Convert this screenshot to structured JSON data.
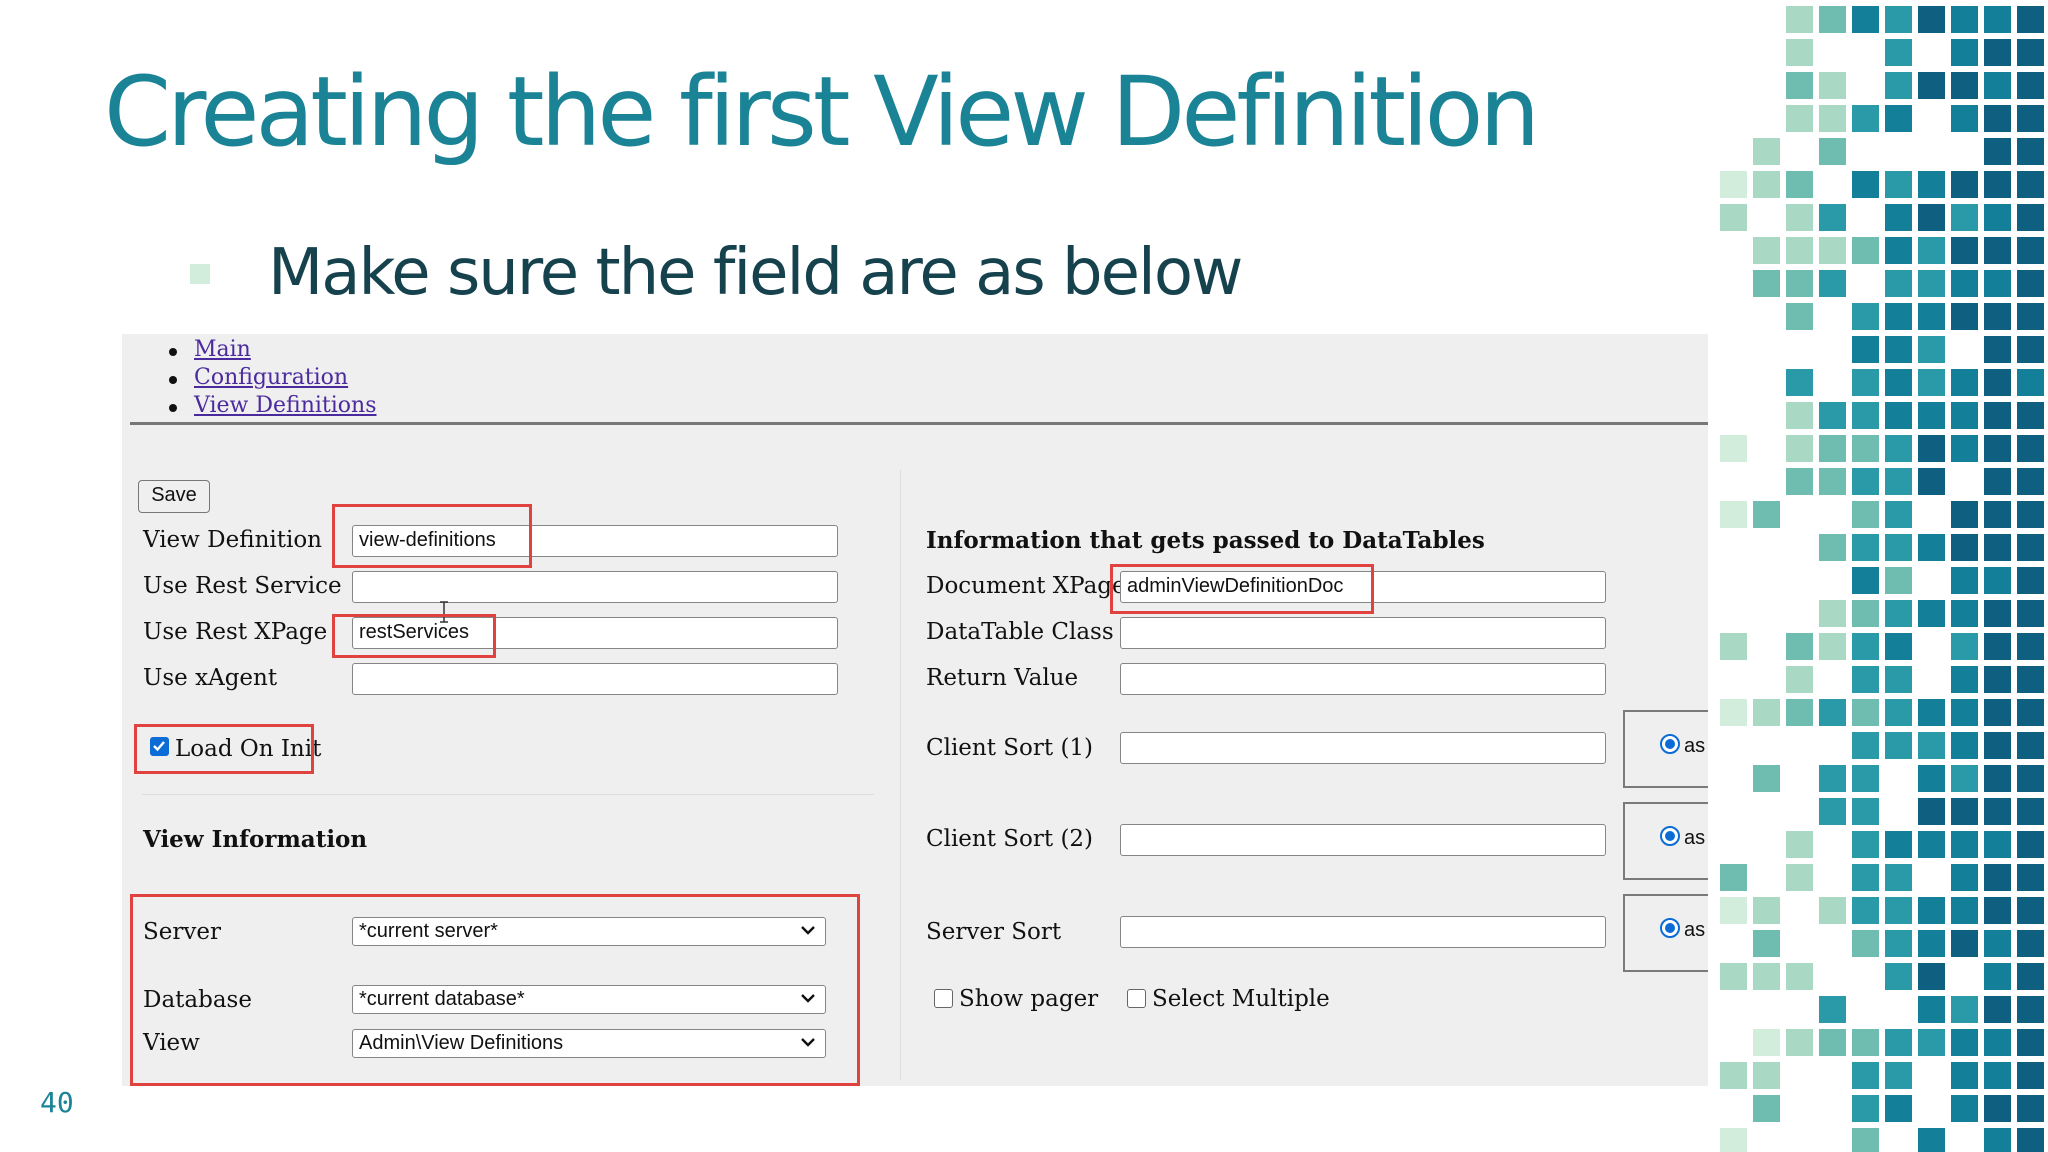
{
  "slide": {
    "title": "Creating the first View Definition",
    "bullet": "Make sure the field are as below",
    "page_number": "40",
    "accent_color": "#1a8395"
  },
  "nav": {
    "items": [
      {
        "label": "Main"
      },
      {
        "label": "Configuration"
      },
      {
        "label": "View Definitions"
      }
    ]
  },
  "form": {
    "save_label": "Save",
    "view_definition": {
      "label": "View Definition",
      "value": "view-definitions"
    },
    "use_rest_service": {
      "label": "Use Rest Service",
      "value": ""
    },
    "use_rest_xpage": {
      "label": "Use Rest XPage",
      "value": "restServices"
    },
    "use_xagent": {
      "label": "Use xAgent",
      "value": ""
    },
    "load_on_init": {
      "label": "Load On Init",
      "checked": true
    },
    "view_info_heading": "View Information",
    "server": {
      "label": "Server",
      "selected": "*current server*"
    },
    "database": {
      "label": "Database",
      "selected": "*current database*"
    },
    "view": {
      "label": "View",
      "selected": "Admin\\View Definitions"
    }
  },
  "datatables": {
    "heading": "Information that gets passed to DataTables",
    "document_xpage": {
      "label": "Document XPage",
      "value": "adminViewDefinitionDoc"
    },
    "datatable_class": {
      "label": "DataTable Class",
      "value": ""
    },
    "return_value": {
      "label": "Return Value",
      "value": ""
    },
    "client_sort_1": {
      "label": "Client Sort (1)",
      "value": "",
      "radio": "as"
    },
    "client_sort_2": {
      "label": "Client Sort (2)",
      "value": "",
      "radio": "as"
    },
    "server_sort": {
      "label": "Server Sort",
      "value": "",
      "radio": "as"
    },
    "show_pager": {
      "label": "Show pager",
      "checked": false
    },
    "select_multiple": {
      "label": "Select Multiple",
      "checked": false
    }
  },
  "highlight_color": "#e0423f"
}
